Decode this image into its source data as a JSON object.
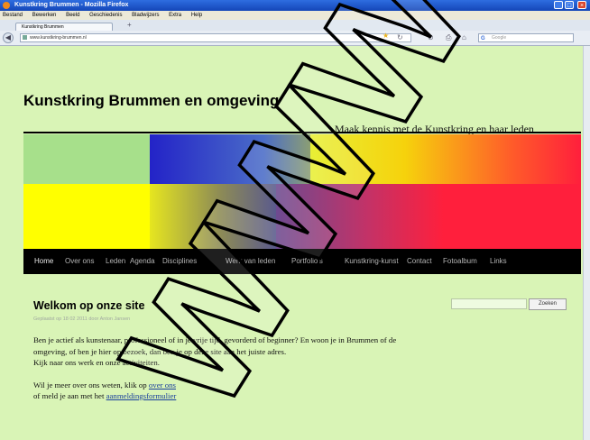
{
  "window": {
    "title": "Kunstkring Brummen - Mozilla Firefox"
  },
  "menubar": [
    "Bestand",
    "Bewerken",
    "Beeld",
    "Geschiedenis",
    "Bladwijzers",
    "Extra",
    "Help"
  ],
  "tab": {
    "label": "Kunstkring Brummen",
    "new_tab": "+"
  },
  "address": {
    "url": "www.kunstkring-brummen.nl"
  },
  "search": {
    "placeholder": "Google"
  },
  "site": {
    "title": "Kunstkring Brummen en omgeving",
    "tagline": "Maak kennis met de Kunstkring en haar leden"
  },
  "nav": [
    "Home",
    "Over ons",
    "Leden",
    "Agenda",
    "Disciplines",
    "Werk van leden",
    "Portfolio's",
    "Kunstkring-kunst",
    "Contact",
    "Fotoalbum",
    "Links"
  ],
  "sidebar": {
    "search_button": "Zoeken"
  },
  "post": {
    "title": "Welkom op onze site",
    "meta": "Geplaatst op 18 02 2011 door Anton Jansen",
    "p1": "Ben je actief als kunstenaar, professioneel of in je vrije tijd, gevorderd of beginner? En woon je in Brummen of de omgeving, of ben je hier op bezoek, dan ben je op deze site aan het juiste  adres.",
    "p2": "Kijk naar ons werk en onze activiteiten.",
    "p3a": "Wil je meer over ons weten, klik op",
    "p3link": "over ons",
    "p4a": "of meld je aan met het",
    "p4link": "aanmeldingsformulier"
  },
  "watermark": {
    "text": "WWW"
  },
  "colors": {
    "page_bg": "#d9f4b6",
    "nav_bg": "#000000",
    "link": "#1a3f9c",
    "banner_yellow": "#ffff00",
    "banner_red": "#ff1f3c",
    "banner_blue": "#2323c8",
    "banner_lightgreen": "#a7e08b"
  }
}
